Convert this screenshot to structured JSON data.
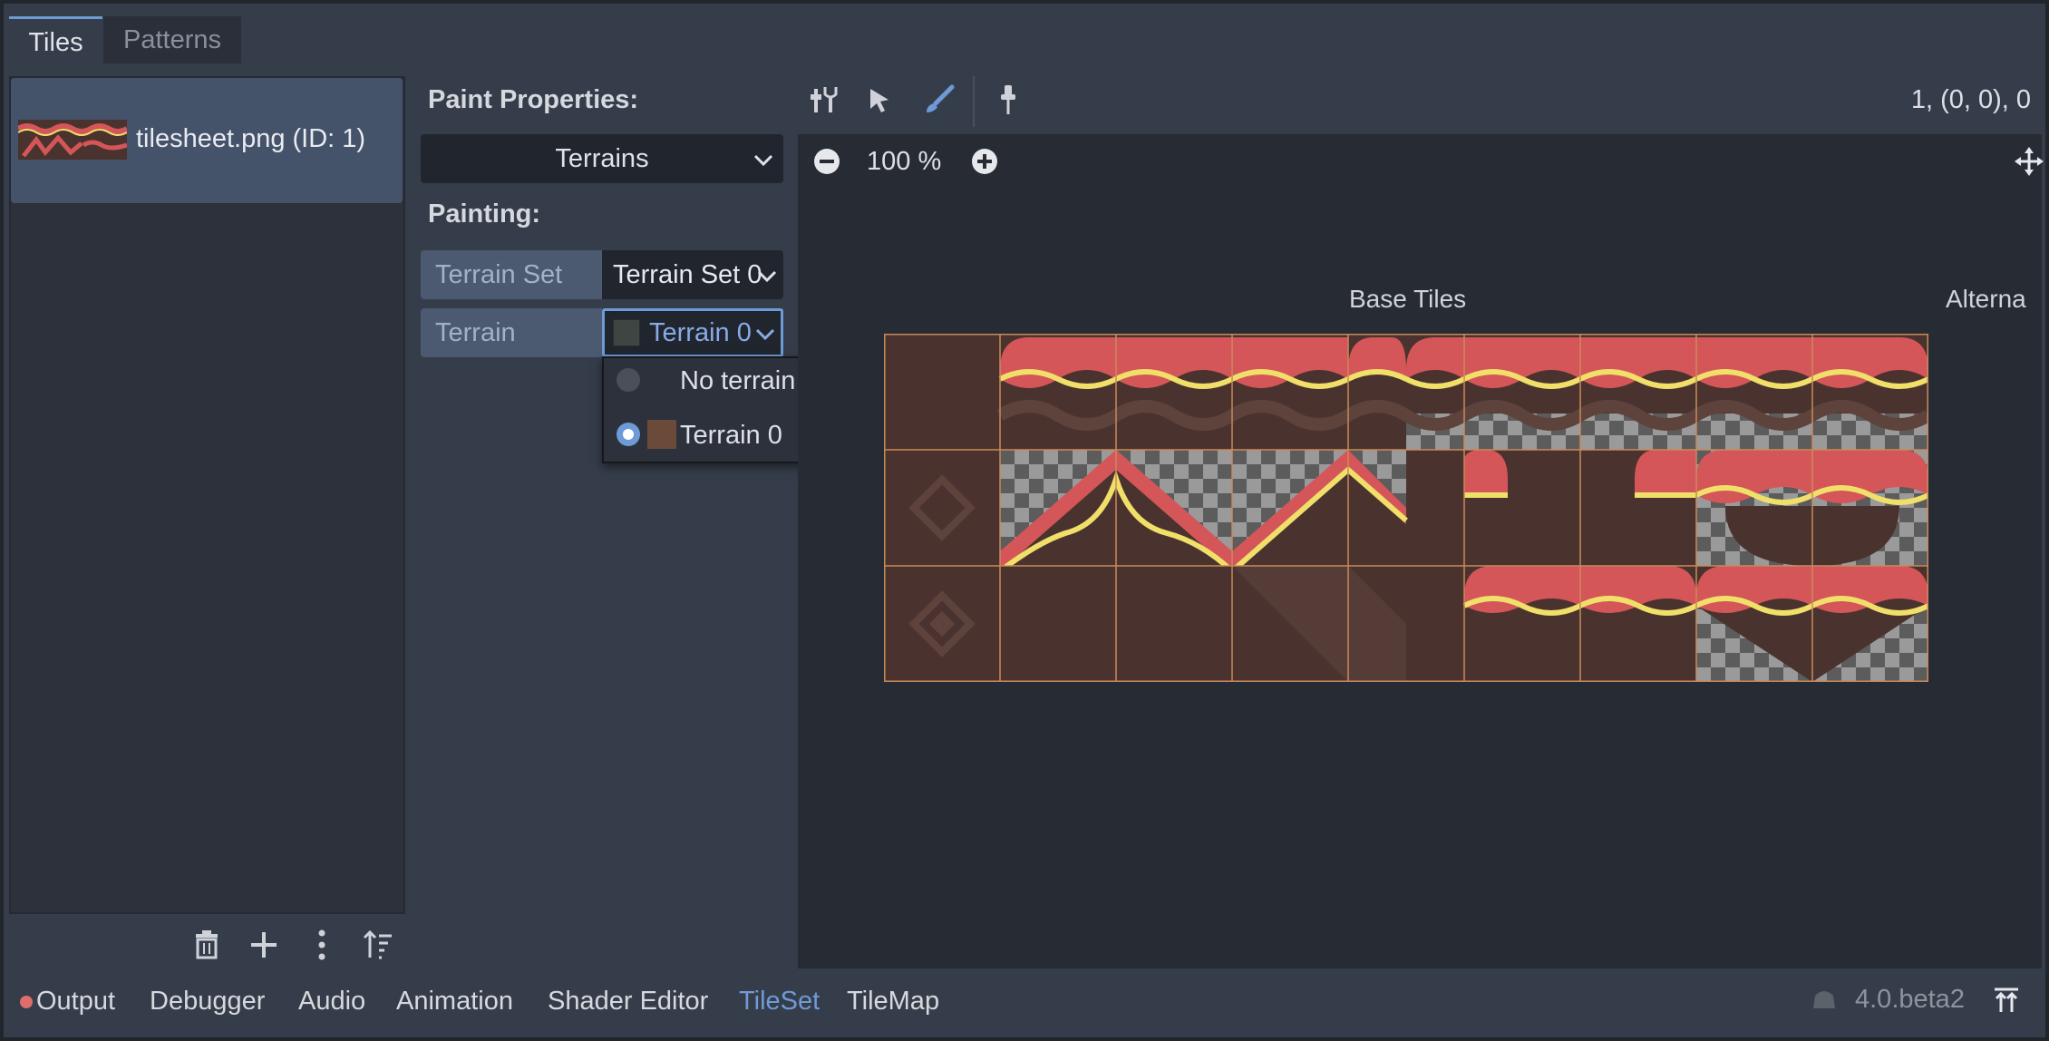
{
  "tabs": [
    {
      "label": "Tiles",
      "active": true
    },
    {
      "label": "Patterns",
      "active": false
    }
  ],
  "sources": [
    {
      "label": "tilesheet.png (ID: 1)",
      "selected": true
    }
  ],
  "source_actions": [
    "trash-icon",
    "add-icon",
    "more-vertical-icon",
    "sort-icon"
  ],
  "paint": {
    "header": "Paint Properties:",
    "mode": "Terrains",
    "painting_header": "Painting:",
    "terrain_set_label": "Terrain Set",
    "terrain_set_value": "Terrain Set 0",
    "terrain_label": "Terrain",
    "terrain_value": "Terrain 0"
  },
  "terrain_popup": {
    "options": [
      {
        "label": "No terrain",
        "selected": false
      },
      {
        "label": "Terrain 0",
        "selected": true,
        "color": "#6b4a3a"
      }
    ]
  },
  "toolbar": {
    "tools": [
      "setup-tool-icon",
      "select-tool-icon",
      "paint-brush-icon",
      "picker-icon"
    ],
    "active_tool": "paint-brush-icon",
    "coords": "1, (0, 0), 0"
  },
  "zoom": {
    "value": "100 %"
  },
  "atlas": {
    "base_label": "Base Tiles",
    "alt_label": "Alterna"
  },
  "bottom_tabs": [
    {
      "label": "Output",
      "active": false,
      "has_alert": true
    },
    {
      "label": "Debugger",
      "active": false
    },
    {
      "label": "Audio",
      "active": false
    },
    {
      "label": "Animation",
      "active": false
    },
    {
      "label": "Shader Editor",
      "active": false
    },
    {
      "label": "TileSet",
      "active": true
    },
    {
      "label": "TileMap",
      "active": false
    }
  ],
  "version": "4.0.beta2",
  "colors": {
    "accent": "#6e9ad6",
    "alert": "#e06c6c",
    "tile_red": "#d45658",
    "tile_yellow": "#f0e06a",
    "tile_dirt": "#4a332e"
  }
}
